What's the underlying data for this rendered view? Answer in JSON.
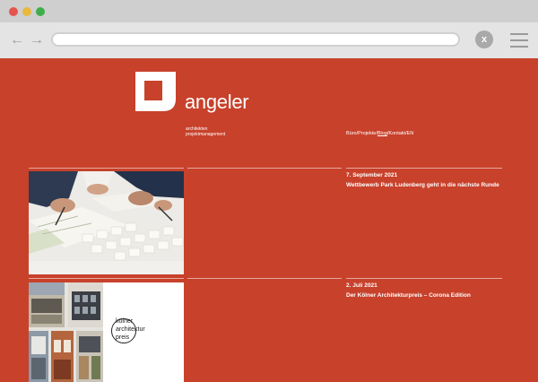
{
  "browser": {
    "back_icon": "arrow-left-icon",
    "forward_icon": "arrow-right-icon",
    "close_label": "x",
    "menu_icon": "hamburger-icon"
  },
  "site": {
    "logo_word": "angeler",
    "tagline_line1": "architekten",
    "tagline_line2": "projektmanagement",
    "brand_color": "#c8412b"
  },
  "nav": {
    "items": [
      "Büro",
      "Projekte",
      "Blog",
      "Kontakt",
      "EN"
    ],
    "separator": "/",
    "active": "Blog"
  },
  "posts": [
    {
      "date": "7. September 2021",
      "title": "Wettbewerb Park Ludenberg geht in die nächste Runde"
    },
    {
      "date": "2. Juli 2021",
      "title": "Der Kölner Architekturpreis – Corona Edition",
      "image_text": [
        "kölner",
        "architektur",
        "preis"
      ]
    }
  ]
}
